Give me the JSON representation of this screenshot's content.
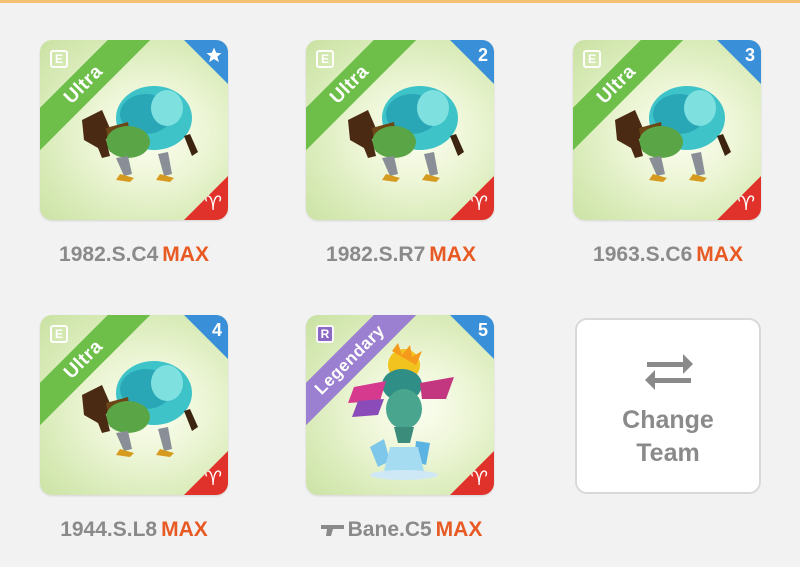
{
  "team": [
    {
      "name": "1982.S.C4",
      "level_badge": "MAX",
      "rarity": "Ultra",
      "type_badge": "E",
      "slot": "star",
      "element_symbol": "♈"
    },
    {
      "name": "1982.S.R7",
      "level_badge": "MAX",
      "rarity": "Ultra",
      "type_badge": "E",
      "slot": "2",
      "element_symbol": "♈"
    },
    {
      "name": "1963.S.C6",
      "level_badge": "MAX",
      "rarity": "Ultra",
      "type_badge": "E",
      "slot": "3",
      "element_symbol": "♈"
    },
    {
      "name": "1944.S.L8",
      "level_badge": "MAX",
      "rarity": "Ultra",
      "type_badge": "E",
      "slot": "4",
      "element_symbol": "♈"
    },
    {
      "name": "Bane.C5",
      "level_badge": "MAX",
      "rarity": "Legendary",
      "type_badge": "R",
      "slot": "5",
      "element_symbol": "♈"
    }
  ],
  "change_team": {
    "line1": "Change",
    "line2": "Team",
    "icon": "swap-arrows-icon"
  },
  "colors": {
    "ultra_ribbon": "#6dbf4a",
    "legendary_ribbon": "#9b7fd0",
    "slot_corner": "#3a8fd9",
    "element_corner": "#e0312b",
    "max_text": "#e85a23",
    "name_text": "#8a8a8a"
  }
}
